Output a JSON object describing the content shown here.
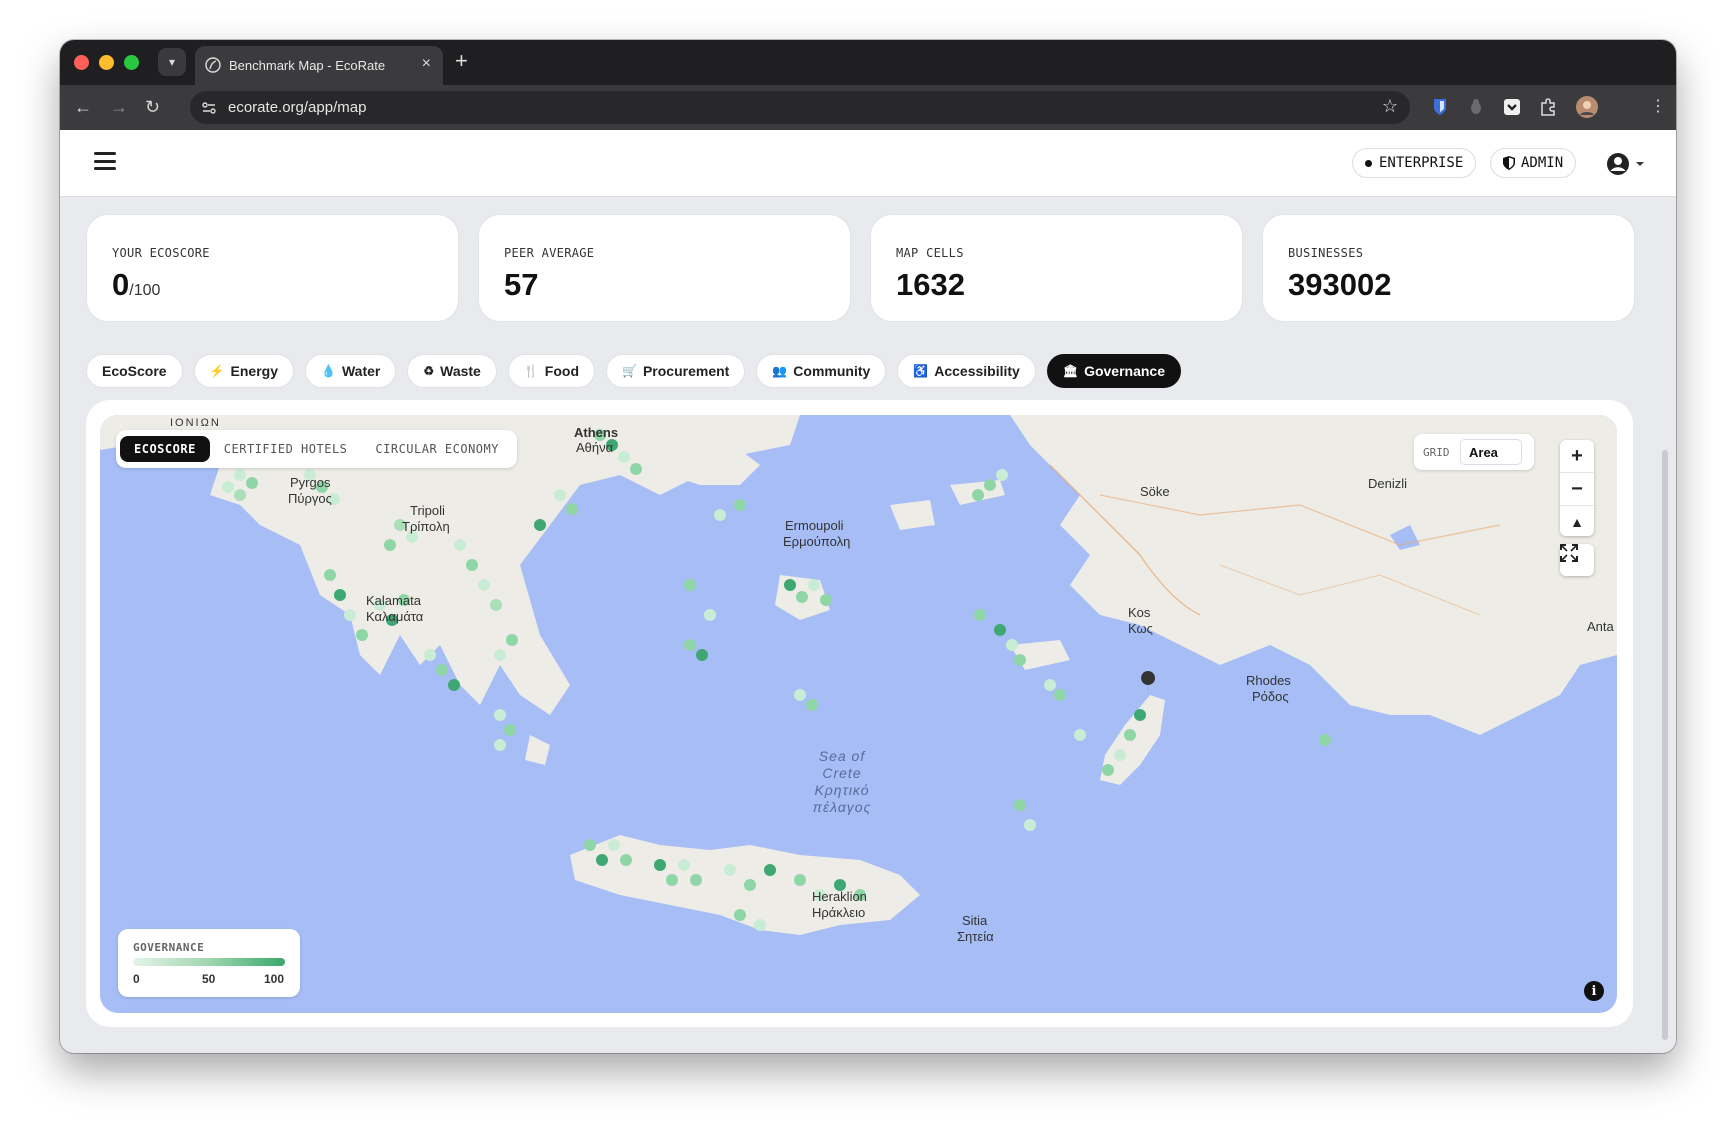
{
  "browser": {
    "tab_title": "Benchmark Map - EcoRate",
    "url": "ecorate.org/app/map"
  },
  "header": {
    "plan_badge": "ENTERPRISE",
    "role_badge": "ADMIN"
  },
  "stats": [
    {
      "label": "YOUR ECOSCORE",
      "value": "0",
      "suffix": "/100"
    },
    {
      "label": "PEER AVERAGE",
      "value": "57",
      "suffix": ""
    },
    {
      "label": "MAP CELLS",
      "value": "1632",
      "suffix": ""
    },
    {
      "label": "BUSINESSES",
      "value": "393002",
      "suffix": ""
    }
  ],
  "filters": [
    {
      "label": "EcoScore",
      "icon": ""
    },
    {
      "label": "Energy",
      "icon": "bolt-icon"
    },
    {
      "label": "Water",
      "icon": "droplet-icon"
    },
    {
      "label": "Waste",
      "icon": "recycle-icon"
    },
    {
      "label": "Food",
      "icon": "utensils-icon"
    },
    {
      "label": "Procurement",
      "icon": "cart-icon"
    },
    {
      "label": "Community",
      "icon": "people-icon"
    },
    {
      "label": "Accessibility",
      "icon": "wheelchair-icon"
    },
    {
      "label": "Governance",
      "icon": "building-icon",
      "active": true
    }
  ],
  "map": {
    "view_toggle": [
      "ECOSCORE",
      "CERTIFIED HOTELS",
      "CIRCULAR ECONOMY"
    ],
    "active_view": "ECOSCORE",
    "grid_label": "GRID",
    "grid_value": "Area",
    "zoom_in": "+",
    "zoom_out": "−",
    "legend": {
      "title": "GOVERNANCE",
      "min": "0",
      "mid": "50",
      "max": "100"
    },
    "labels": {
      "ionian": "ΙΟΝΙΩΝ",
      "athens": "Athens",
      "athens_gr": "Αθήνα",
      "pyrgos": "Pyrgos",
      "pyrgos_gr": "Πύργος",
      "tripoli": "Tripoli",
      "tripoli_gr": "Τρίπολη",
      "kalamata": "Kalamata",
      "kalamata_gr": "Καλαμάτα",
      "ermoupoli": "Ermoupoli",
      "ermoupoli_gr": "Ερμούπολη",
      "soke": "Söke",
      "denizli": "Denizli",
      "kos": "Kos",
      "kos_gr": "Κως",
      "rhodes": "Rhodes",
      "rhodes_gr": "Ρόδος",
      "antalya": "Anta",
      "sea1": "Sea of",
      "sea2": "Crete",
      "sea3": "Κρητικό",
      "sea4": "πέλαγος",
      "heraklion": "Heraklion",
      "heraklion_gr": "Ηράκλειο",
      "sitia": "Sitia",
      "sitia_gr": "Σητεία"
    },
    "colors": {
      "water": "#a6bdf6",
      "land": "#eeece6",
      "hex_light": "#c9ecd4",
      "hex_mid": "#8fd6a6",
      "hex_dark": "#3fa872"
    }
  }
}
